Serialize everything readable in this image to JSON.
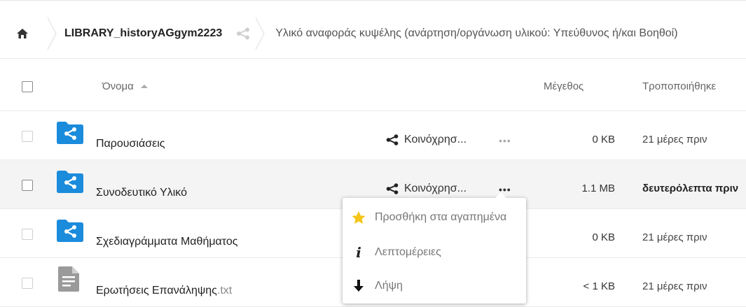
{
  "breadcrumb": {
    "library": "LIBRARY_historyAGgym2223",
    "folder": "Υλικό αναφοράς κυψέλης (ανάρτηση/οργάνωση υλικού: Υπεύθυνος ή/και Βοηθοί)"
  },
  "table": {
    "headers": {
      "name": "Όνομα",
      "size": "Μέγεθος",
      "modified": "Τροποποιήθηκε"
    },
    "rows": [
      {
        "name": "Παρουσιάσεις",
        "ext": "",
        "type": "shared-folder",
        "share": "Κοινόχρησ...",
        "size": "0 KB",
        "modified": "21 μέρες πριν"
      },
      {
        "name": "Συνοδευτικό Υλικό",
        "ext": "",
        "type": "shared-folder",
        "share": "Κοινόχρησ...",
        "size": "1.1 MB",
        "modified": "δευτερόλεπτα πριν"
      },
      {
        "name": "Σχεδιαγράμματα Μαθήματος",
        "ext": "",
        "type": "shared-folder",
        "share": "",
        "size": "0 KB",
        "modified": "21 μέρες πριν"
      },
      {
        "name": "Ερωτήσεις Επανάληψης",
        "ext": ".txt",
        "type": "text-file",
        "share": "",
        "size": "< 1 KB",
        "modified": "21 μέρες πριν"
      }
    ],
    "more_glyph": "•••"
  },
  "context_menu": {
    "items": [
      {
        "label": "Προσθήκη στα αγαπημένα",
        "icon": "star-icon"
      },
      {
        "label": "Λεπτομέρειες",
        "icon": "info-icon"
      },
      {
        "label": "Λήψη",
        "icon": "download-icon"
      }
    ],
    "info_glyph": "i"
  },
  "colors": {
    "folder_blue": "#1b8bdc",
    "star_yellow": "#f5c518",
    "file_grey": "#9a9a9a"
  }
}
